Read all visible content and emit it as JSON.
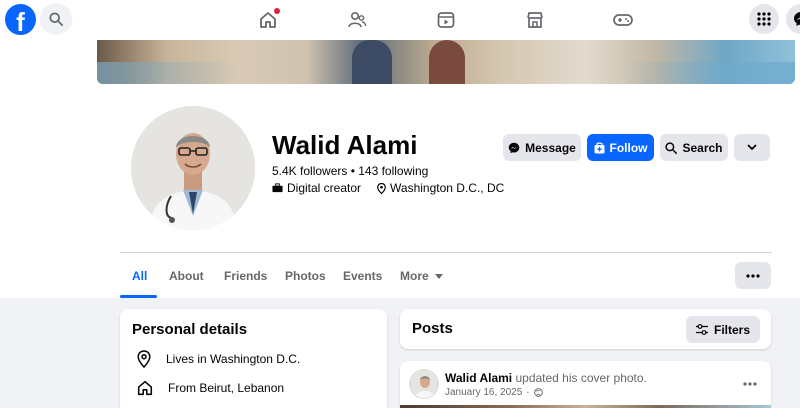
{
  "nav": {
    "logo_letter": "f",
    "icons": [
      "home-icon",
      "friends-icon",
      "video-icon",
      "marketplace-icon",
      "gaming-icon"
    ],
    "right_icons": [
      "apps-menu-icon",
      "messenger-icon"
    ]
  },
  "profile": {
    "name": "Walid Alami",
    "stats": "5.4K followers • 143 following",
    "category": "Digital creator",
    "location": "Washington D.C., DC"
  },
  "actions": {
    "message": "Message",
    "follow": "Follow",
    "search": "Search"
  },
  "tabs": [
    "All",
    "About",
    "Friends",
    "Photos",
    "Events",
    "More"
  ],
  "personal_details": {
    "title": "Personal details",
    "items": [
      {
        "icon": "location-pin-icon",
        "text": "Lives in Washington D.C."
      },
      {
        "icon": "home-icon",
        "text": "From Beirut, Lebanon"
      }
    ]
  },
  "posts": {
    "title": "Posts",
    "filters_label": "Filters",
    "first_post": {
      "author": "Walid Alami",
      "action": "updated his cover photo.",
      "date": "January 16, 2025"
    }
  },
  "colors": {
    "brand_blue": "#0866ff",
    "grey_button": "#e4e6eb",
    "page_bg": "#f0f2f5",
    "notification_red": "#e41e3f"
  }
}
